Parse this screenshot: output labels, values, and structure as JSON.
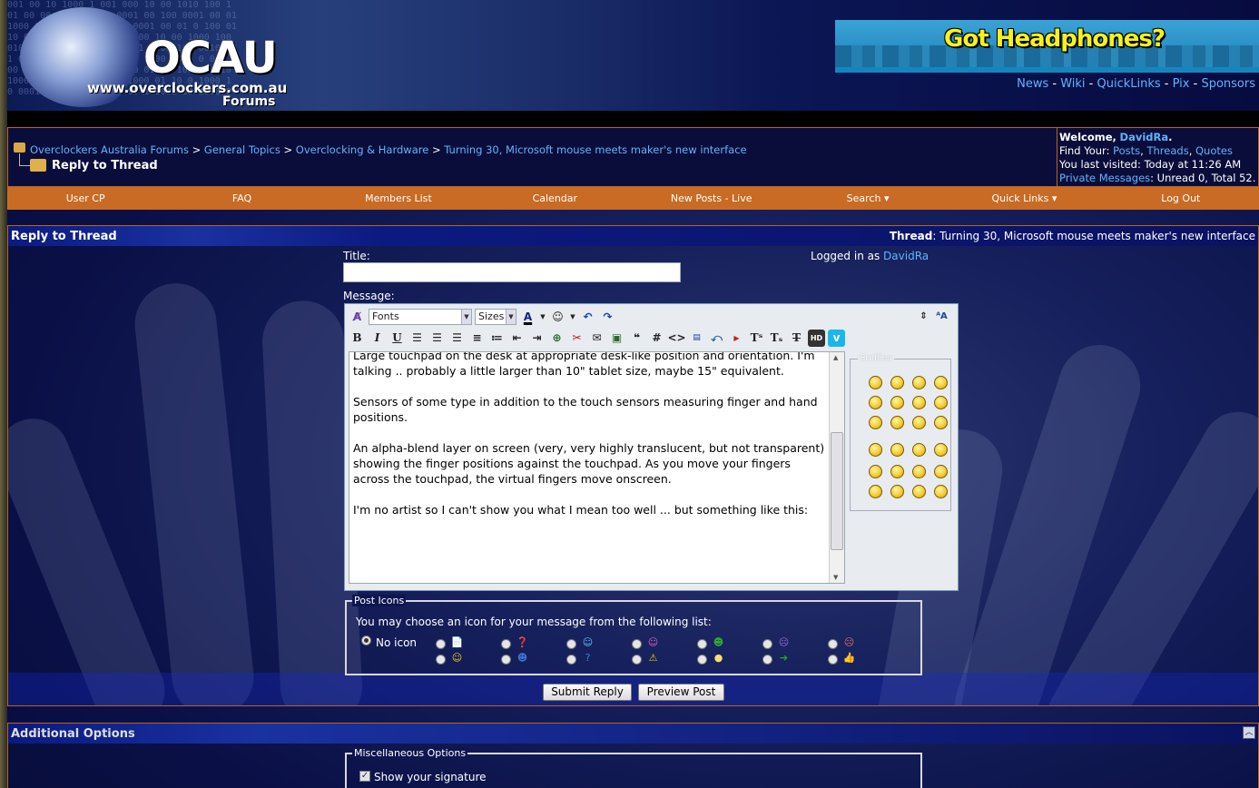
{
  "header": {
    "binary_bg": "001 00 10 1000 1 001 000 10 00 1010 100 1\n01 00 00 100 1001 0 0001 00 100 0001 00 01\n1000 01 10 1000 100 01 0001 00 01 0 100 01\n10 0 1000 0100 00 100 1000 10 00 1000 100\n0101 00 10 0010 00 01 001 1000 100 0010 10\n1 00 0100 001 1000 01 00 1000 1000 0 001 0\n00 1 100 01 0001 1000 00 01000 100 000 10\n1000 100 1000 0001 00 1000 01 10 0 1000 1\n0 0001 00 10 1000 001 00 1 0001 10 1000 0",
    "logo": "OCAU",
    "url": "www.overclockers.com.au",
    "forums": "Forums",
    "ad_text": "Got Headphones?",
    "toplinks": [
      "News",
      "Wiki",
      "QuickLinks",
      "Pix",
      "Sponsors"
    ],
    "sep": " - "
  },
  "breadcrumb": {
    "items": [
      "Overclockers Australia Forums",
      "General Topics",
      "Overclocking & Hardware",
      "Turning 30, Microsoft mouse meets maker's new interface"
    ],
    "sep": " > ",
    "current": "Reply to Thread"
  },
  "welcome": {
    "label": "Welcome,",
    "user": "DavidRa",
    "dot": ".",
    "find_label": "Find Your: ",
    "find_links": [
      "Posts",
      "Threads",
      "Quotes"
    ],
    "last_visit": "You last visited: Today at 11:26 AM",
    "pm_link": "Private Messages",
    "pm_text": ": Unread 0, Total 52."
  },
  "navbar": [
    "User CP",
    "FAQ",
    "Members List",
    "Calendar",
    "New Posts - Live",
    "Search ▾",
    "Quick Links ▾",
    "Log Out"
  ],
  "reply": {
    "panel_title": "Reply to Thread",
    "thread_label": "Thread",
    "thread_title": ": Turning 30, Microsoft mouse meets maker's new interface",
    "title_label": "Title:",
    "title_value": "",
    "logged_in_label": "Logged in as ",
    "logged_in_user": "DavidRa",
    "message_label": "Message:",
    "fonts": "Fonts",
    "sizes": "Sizes",
    "message_text": "Large touchpad on the desk at appropriate desk-like position and orientation. I'm talking .. probably a little larger than 10\" tablet size, maybe 15\" equivalent.\n\nSensors of some type in addition to the touch sensors measuring finger and hand positions.\n\nAn alpha-blend layer on screen (very, very highly translucent, but not transparent) showing the finger positions against the touchpad. As you move your fingers across the touchpad, the virtual fingers move onscreen.\n\nI'm no artist so I can't show you what I mean too well ... but something like this:",
    "smilies_legend": "Smilies",
    "post_icons_legend": "Post Icons",
    "post_icons_prompt": "You may choose an icon for your message from the following list:",
    "no_icon": "No icon",
    "submit": "Submit Reply",
    "preview": "Preview Post"
  },
  "additional": {
    "title": "Additional Options",
    "misc_legend": "Miscellaneous Options",
    "show_signature": "Show your signature"
  },
  "colors": {
    "link": "#5fb4ff",
    "nav_orange": "#c96b24",
    "panel_border": "#b8651f",
    "page_bg": "#0a1046"
  }
}
